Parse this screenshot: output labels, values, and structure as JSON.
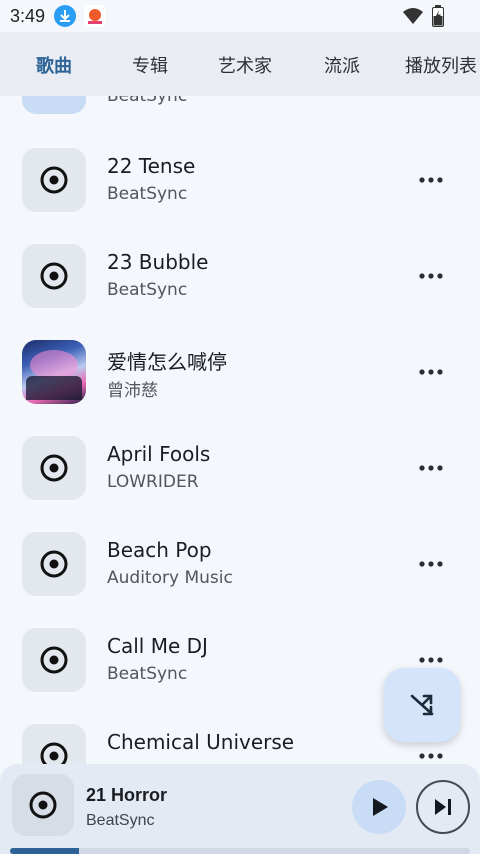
{
  "status_bar": {
    "time": "3:49",
    "icons": [
      "download-icon",
      "app-notification-icon",
      "wifi-icon",
      "battery-charging-icon"
    ]
  },
  "tabs": [
    {
      "label": "歌曲",
      "active": true
    },
    {
      "label": "专辑",
      "active": false
    },
    {
      "label": "艺术家",
      "active": false
    },
    {
      "label": "流派",
      "active": false
    },
    {
      "label": "播放列表",
      "active": false
    }
  ],
  "songs": [
    {
      "title": "",
      "artist": "BeatSync",
      "art": "music-disc-icon"
    },
    {
      "title": "22 Tense",
      "artist": "BeatSync",
      "art": "music-disc-icon"
    },
    {
      "title": "23 Bubble",
      "artist": "BeatSync",
      "art": "music-disc-icon"
    },
    {
      "title": "爱情怎么喊停",
      "artist": "曾沛慈",
      "art": "album-cover"
    },
    {
      "title": "April Fools",
      "artist": "LOWRIDER",
      "art": "music-disc-icon"
    },
    {
      "title": "Beach Pop",
      "artist": "Auditory Music",
      "art": "music-disc-icon"
    },
    {
      "title": "Call Me DJ",
      "artist": "BeatSync",
      "art": "music-disc-icon"
    },
    {
      "title": "Chemical Universe",
      "artist": "",
      "art": "music-disc-icon"
    }
  ],
  "row_actions": {
    "more_icon": "more-horizontal-icon"
  },
  "fab": {
    "icon": "shuffle-icon"
  },
  "now_playing": {
    "title": "21 Horror",
    "artist": "BeatSync",
    "progress": 0.15,
    "play_icon": "play-icon",
    "next_icon": "skip-next-icon"
  },
  "colors": {
    "accent": "#2d6396",
    "background": "#f4f7fc",
    "tab_bar": "#e9edf3",
    "fab": "#d4e4fb"
  }
}
